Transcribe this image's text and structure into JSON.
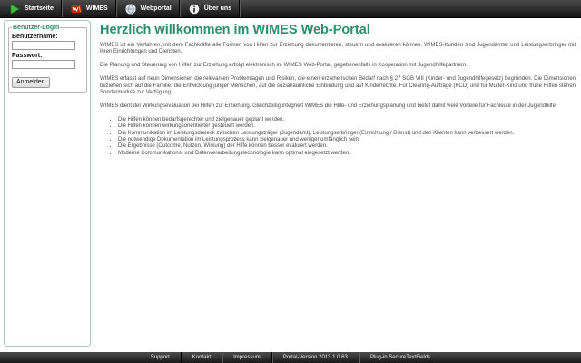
{
  "nav": {
    "items": [
      {
        "label": "Startseite",
        "icon": "play-icon"
      },
      {
        "label": "WIMES",
        "icon": "wimes-logo-icon"
      },
      {
        "label": "Webportal",
        "icon": "globe-icon"
      },
      {
        "label": "Über uns",
        "icon": "info-icon"
      }
    ]
  },
  "login": {
    "legend": "Benutzer-Login",
    "username_label": "Benutzername:",
    "username_value": "",
    "password_label": "Passwort:",
    "password_value": "",
    "submit_label": "Anmelden"
  },
  "main": {
    "title": "Herzlich willkommen im WIMES Web-Portal",
    "paragraphs": [
      "WIMES ist ein Verfahren, mit dem Fachkräfte alle Formen von Hilfen zur Erziehung dokumentieren, steuern und evaluieren können. WIMES-Kunden sind Jugendämter und Leistungserbringer mit ihren Einrichtungen und Diensten.",
      "Die Planung und Steuerung von Hilfen zur Erziehung erfolgt elektronisch im WIMES Web-Portal, gegebenenfalls in Kooperation mit Jugendhilfepartnern.",
      "WIMES erfasst auf neun Dimensionen die relevanten Problemlagen und Risiken, die einen erzieherischen Bedarf nach § 27 SGB VIII (Kinder- und Jugendhilfegesetz) begründen. Die Dimensionen beziehen sich auf die Familie, die Entwicklung junger Menschen, auf die sozialräumliche Einbindung und auf Kinderrechte. Für Clearing-Aufträge (KCD) und für Mutter-Kind und frühe Hilfen stehen Sondermodule zur Verfügung.",
      "WIMES dient der Wirkungsevaluation bei Hilfen zur Erziehung. Gleichzeitig integriert WIMES die Hilfe- und Erziehungsplanung und bietet damit viele Vorteile für Fachleute in der Jugendhilfe:"
    ],
    "bullets": [
      "Die Hilfen können bedarfsgerechter und zielgenauer geplant werden.",
      "Die Hilfen können wirkungsorientierter gesteuert werden.",
      "Die Kommunikation im Leistungsdreieck zwischen Leistungsträger (Jugendamt), Leistungserbringer (Einrichtung / Dienst) und den Klienten kann verbessert werden.",
      "Die notwendige Dokumentation im Leistungsprozess kann zielgenauer und weniger umfänglich sein.",
      "Die Ergebnisse (Outcome, Nutzen, Wirkung) der Hilfe können besser evaluiert werden.",
      "Moderne Kommunikations- und Datenverarbeitungstechnologie kann optimal eingesetzt werden."
    ]
  },
  "footer": {
    "items": [
      "Support",
      "Kontakt",
      "Impressum",
      "Portal-Version 2013.1.0.63",
      "Plug-in SecureTextFields"
    ]
  }
}
